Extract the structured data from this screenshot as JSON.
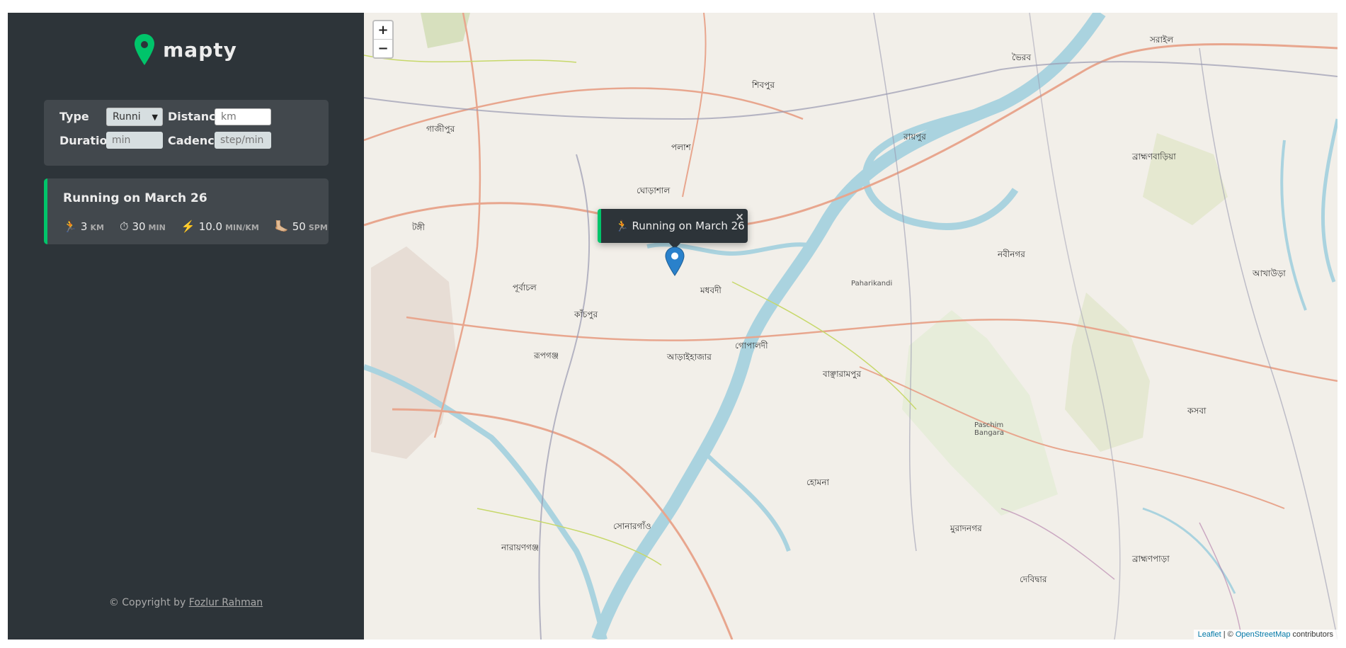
{
  "sidebar": {
    "logo_text": "mapty",
    "form": {
      "type_label": "Type",
      "type_value": "Runni",
      "distance_label": "Distance",
      "distance_placeholder": "km",
      "duration_label": "Duration",
      "duration_placeholder": "min",
      "cadence_label": "Cadence",
      "cadence_placeholder": "step/min"
    },
    "workouts": [
      {
        "title": "Running on March 26",
        "details": [
          {
            "icon": "🏃",
            "value": "3",
            "unit": "km"
          },
          {
            "icon": "⏱",
            "value": "30",
            "unit": "min"
          },
          {
            "icon": "⚡️",
            "value": "10.0",
            "unit": "min/km"
          },
          {
            "icon": "🦶🏼",
            "value": "50",
            "unit": "spm"
          }
        ]
      }
    ],
    "copyright_prefix": "© Copyright by",
    "copyright_author": "Fozlur Rahman"
  },
  "map": {
    "zoom_in": "+",
    "zoom_out": "−",
    "popup_text": "🏃 Running on March 26",
    "popup_close": "×",
    "attribution_leaflet": "Leaflet",
    "attribution_sep": " | © ",
    "attribution_osm": "OpenStreetMap",
    "attribution_suffix": " contributors",
    "labels": [
      "শিবপুর",
      "গাজীপুর",
      "পলাশ",
      "ঘোড়াশাল",
      "টঙ্গী",
      "পূর্বাচল",
      "রূপগঞ্জ",
      "কাঁচপুর",
      "মধবদী",
      "আড়াইহাজার",
      "গোপালদী",
      "রায়পুর",
      "ভৈরব",
      "নবীনগর",
      "বাঞ্ছারামপুর",
      "নারায়ণগঞ্জ",
      "সোনারগাঁও",
      "হোমনা",
      "মুরাদনগর",
      "দেবিদ্বার",
      "ব্রাহ্মণপাড়া",
      "কসবা",
      "আখাউড়া",
      "সরাইল",
      "ব্রাহ্মণবাড়িয়া",
      "Paharikandi",
      "Paschim Bangara"
    ],
    "colors": {
      "accent": "#00c46a",
      "sidebar_bg": "#2d3439",
      "panel_bg": "#42484d",
      "marker": "#2a81cb",
      "river": "#aad3df"
    }
  }
}
